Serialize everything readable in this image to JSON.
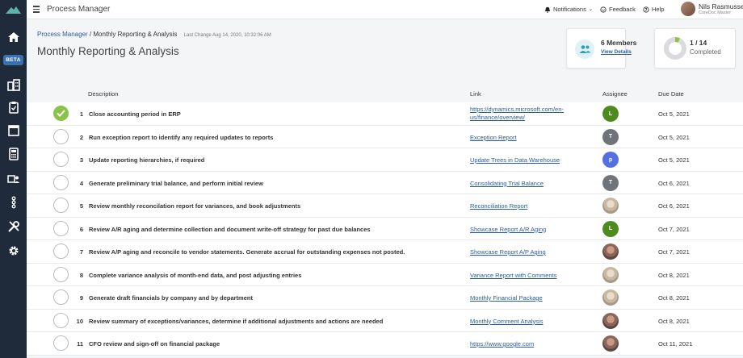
{
  "app": {
    "title": "Process Manager"
  },
  "sidebar": {
    "beta_label": "BETA",
    "icons": [
      "home-icon",
      "building-icon",
      "clipboard-icon",
      "browser-window-icon",
      "calculator-icon",
      "user-card-icon",
      "workflow-icon",
      "tools-icon",
      "gear-icon"
    ]
  },
  "topbar": {
    "notifications_label": "Notifications",
    "feedback_label": "Feedback",
    "help_label": "Help",
    "user_name": "Nils Rasmussen",
    "user_role": "CoreDoc Master"
  },
  "breadcrumb": {
    "parent": "Process Manager",
    "separator": " / ",
    "current": "Monthly Reporting & Analysis",
    "last_change": "Last Change Aug 14, 2020, 10:32:06 AM"
  },
  "page_title": "Monthly Reporting & Analysis",
  "members_card": {
    "count_label": "6 Members",
    "link_label": "View Details"
  },
  "progress_card": {
    "count_label": "1 / 14",
    "status_label": "Completed",
    "completed": 1,
    "total": 14
  },
  "colors": {
    "accent": "#2a5d9f",
    "complete": "#8bc34a",
    "sidebar": "#1f2b3b"
  },
  "table": {
    "headers": {
      "description": "Description",
      "link": "Link",
      "assignee": "Assignee",
      "due_date": "Due Date"
    },
    "rows": [
      {
        "num": "1",
        "done": true,
        "description": "Close accounting period in ERP",
        "link": "https://dynamics.microsoft.com/en-us/finance/overview/",
        "assignee_initial": "L",
        "assignee_color": "#4e8b1f",
        "assignee_type": "initial",
        "due": "Oct 5, 2021"
      },
      {
        "num": "2",
        "done": false,
        "description": "Run exception report to identify any required updates to reports",
        "link": "Exception Report",
        "assignee_initial": "T",
        "assignee_color": "#6e7479",
        "assignee_type": "initial",
        "due": "Oct 5, 2021"
      },
      {
        "num": "3",
        "done": false,
        "description": "Update reporting hierarchies, if required",
        "link": "Update Trees in Data Warehouse",
        "assignee_initial": "p",
        "assignee_color": "#5470e0",
        "assignee_type": "initial",
        "due": "Oct 5, 2021"
      },
      {
        "num": "4",
        "done": false,
        "description": "Generate preliminary trial balance, and perform initial review",
        "link": "Consolidating Trial Balance",
        "assignee_initial": "T",
        "assignee_color": "#6e7479",
        "assignee_type": "initial",
        "due": "Oct 6, 2021"
      },
      {
        "num": "5",
        "done": false,
        "description": "Review monthly reconcilation report for variances, and book adjustments",
        "link": "Reconciliation Report",
        "assignee_initial": "",
        "assignee_color": "",
        "assignee_type": "photo-f",
        "due": "Oct 6, 2021"
      },
      {
        "num": "6",
        "done": false,
        "description": "Review A/R aging and determine collection and document write-off strategy for past due balances",
        "link": "Showcase Report A/R Aging",
        "assignee_initial": "L",
        "assignee_color": "#4e8b1f",
        "assignee_type": "initial",
        "due": "Oct 7, 2021"
      },
      {
        "num": "7",
        "done": false,
        "description": "Review A/P aging and reconcile to vendor statements. Generate accrual for outstanding expenses not posted.",
        "link": "Showcase Report A/P Aging",
        "assignee_initial": "",
        "assignee_color": "",
        "assignee_type": "photo-m",
        "due": "Oct 7, 2021"
      },
      {
        "num": "8",
        "done": false,
        "description": "Complete variance analysis of month-end data, and post adjusting entries",
        "link": "Variance Report with Comments",
        "assignee_initial": "",
        "assignee_color": "",
        "assignee_type": "photo-f",
        "due": "Oct 8, 2021"
      },
      {
        "num": "9",
        "done": false,
        "description": "Generate draft financials by company and by department",
        "link": "Monthly Financial Package",
        "assignee_initial": "",
        "assignee_color": "",
        "assignee_type": "photo-f",
        "due": "Oct 8, 2021"
      },
      {
        "num": "10",
        "done": false,
        "description": "Review summary of exceptions/variances, determine if additional adjustments and actions are needed",
        "link": "Monthly Comment Analysis",
        "assignee_initial": "",
        "assignee_color": "",
        "assignee_type": "photo-m",
        "due": "Oct 8, 2021"
      },
      {
        "num": "11",
        "done": false,
        "description": "CFO review and sign-off on financial package",
        "link": "https://www.google.com",
        "assignee_initial": "",
        "assignee_color": "",
        "assignee_type": "photo-m",
        "due": "Oct 11, 2021"
      }
    ]
  }
}
